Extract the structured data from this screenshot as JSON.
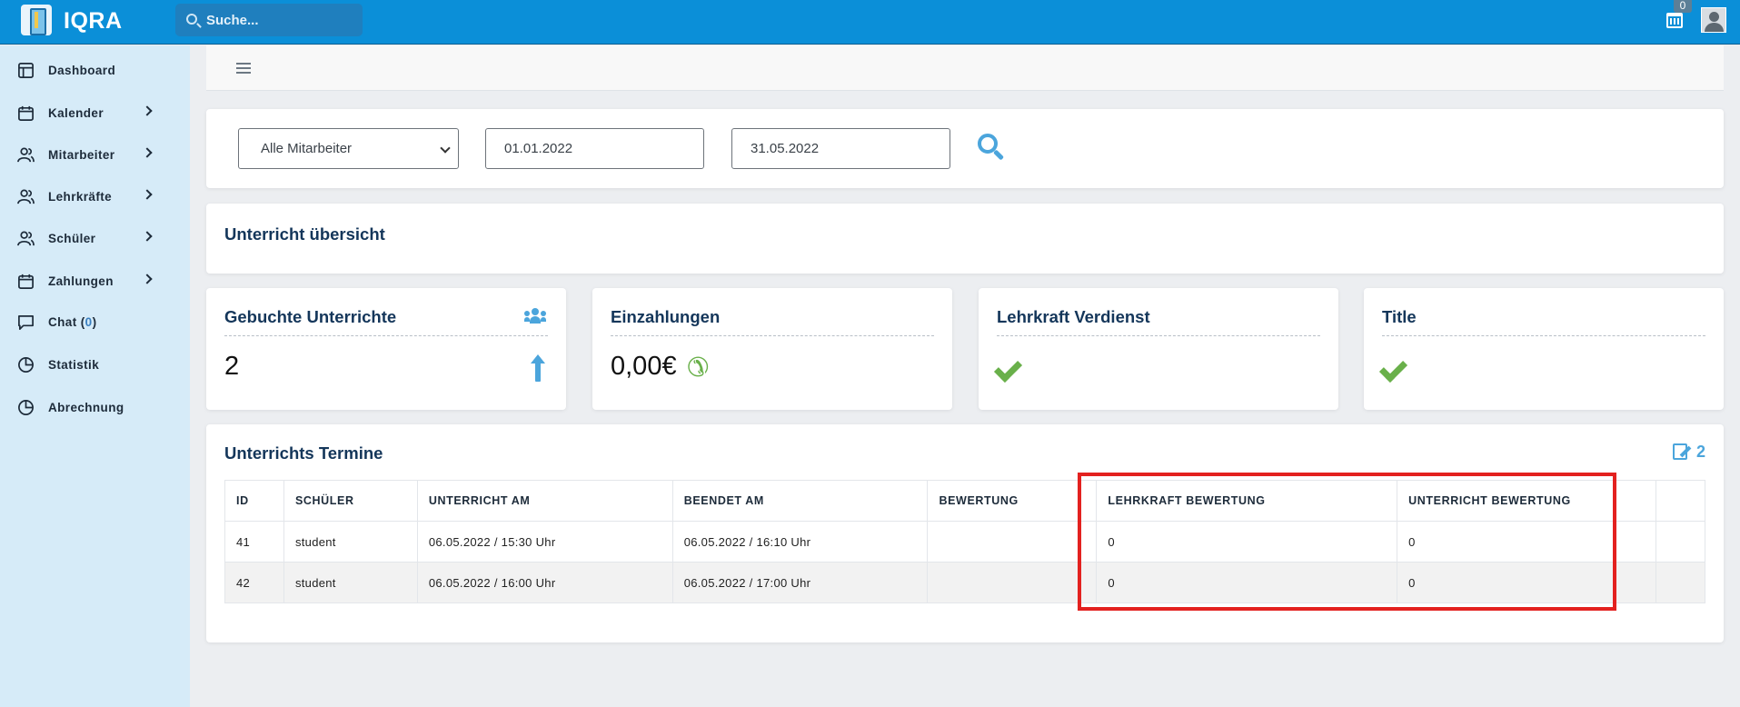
{
  "app": {
    "brand": "IQRA",
    "search_placeholder": "Suche...",
    "calendar_badge": "0"
  },
  "sidebar": {
    "items": [
      {
        "label": "Dashboard",
        "has_children": false
      },
      {
        "label": "Kalender",
        "has_children": true
      },
      {
        "label": "Mitarbeiter",
        "has_children": true
      },
      {
        "label": "Lehrkräfte",
        "has_children": true
      },
      {
        "label": "Schüler",
        "has_children": true
      },
      {
        "label": "Zahlungen",
        "has_children": true
      },
      {
        "label": "Chat",
        "count": "0",
        "has_children": false
      },
      {
        "label": "Statistik",
        "has_children": false
      },
      {
        "label": "Abrechnung",
        "has_children": false
      }
    ]
  },
  "filter": {
    "employee_select": "Alle Mitarbeiter",
    "date_from": "01.01.2022",
    "date_to": "31.05.2022"
  },
  "overview": {
    "title": "Unterricht übersicht"
  },
  "stats": [
    {
      "title": "Gebuchte Unterrichte",
      "value": "2"
    },
    {
      "title": "Einzahlungen",
      "value": "0,00€"
    },
    {
      "title": "Lehrkraft Verdienst",
      "value": ""
    },
    {
      "title": "Title",
      "value": ""
    }
  ],
  "table": {
    "title": "Unterrichts Termine",
    "edit_count": "2",
    "columns": [
      "ID",
      "SCHÜLER",
      "UNTERRICHT AM",
      "BEENDET AM",
      "BEWERTUNG",
      "LEHRKRAFT BEWERTUNG",
      "UNTERRICHT BEWERTUNG",
      ""
    ],
    "rows": [
      [
        "41",
        "student",
        "06.05.2022 / 15:30 Uhr",
        "06.05.2022 / 16:10 Uhr",
        "",
        "0",
        "0",
        ""
      ],
      [
        "42",
        "student",
        "06.05.2022 / 16:00 Uhr",
        "06.05.2022 / 17:00 Uhr",
        "",
        "0",
        "0",
        ""
      ]
    ]
  },
  "colors": {
    "topbar": "#0b8fd8",
    "sidebar": "#d6ebf8",
    "accent_blue": "#4ba5dc",
    "check_green": "#69b04a",
    "highlight_red": "#e3211f"
  }
}
